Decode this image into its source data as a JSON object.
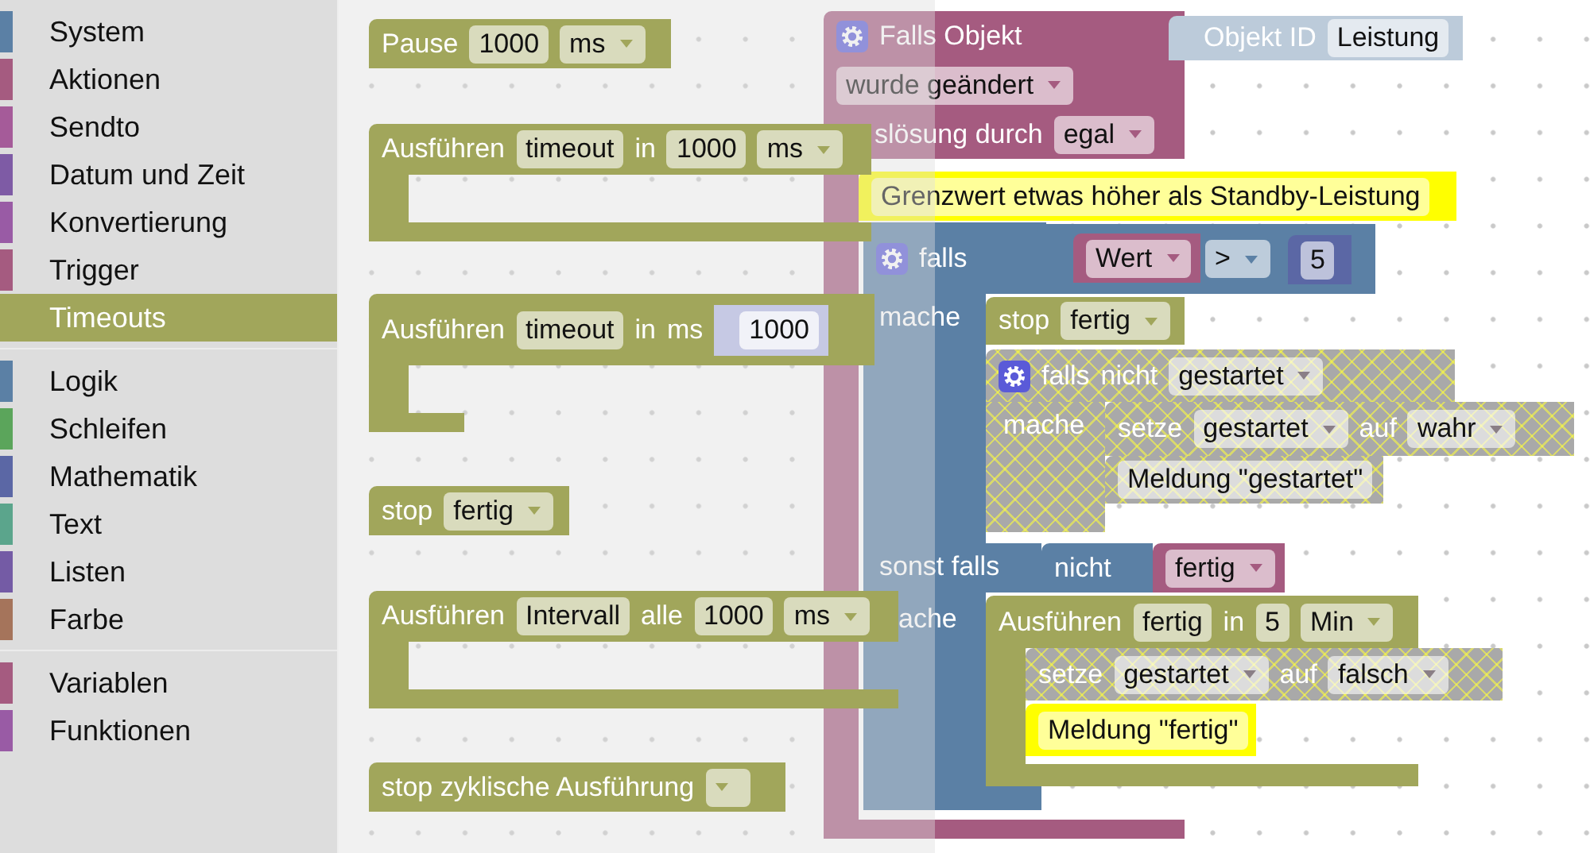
{
  "toolbox": {
    "groups": [
      [
        {
          "label": "System",
          "color": "#5b80a5",
          "selected": false
        },
        {
          "label": "Aktionen",
          "color": "#a55b80",
          "selected": false
        },
        {
          "label": "Sendto",
          "color": "#a55b99",
          "selected": false
        },
        {
          "label": "Datum und Zeit",
          "color": "#7e5ba5",
          "selected": false
        },
        {
          "label": "Konvertierung",
          "color": "#995ba5",
          "selected": false
        },
        {
          "label": "Trigger",
          "color": "#a55b80",
          "selected": false
        },
        {
          "label": "Timeouts",
          "color": "#a1a65b",
          "selected": true
        }
      ],
      [
        {
          "label": "Logik",
          "color": "#5b80a5",
          "selected": false
        },
        {
          "label": "Schleifen",
          "color": "#5ba55b",
          "selected": false
        },
        {
          "label": "Mathematik",
          "color": "#5b67a5",
          "selected": false
        },
        {
          "label": "Text",
          "color": "#5ba58c",
          "selected": false
        },
        {
          "label": "Listen",
          "color": "#745ba5",
          "selected": false
        },
        {
          "label": "Farbe",
          "color": "#a5745b",
          "selected": false
        }
      ],
      [
        {
          "label": "Variablen",
          "color": "#a55b80",
          "selected": false
        },
        {
          "label": "Funktionen",
          "color": "#995ba5",
          "selected": false
        }
      ]
    ]
  },
  "workspace": {
    "blocks": [
      {
        "color": "#a55b80",
        "lines": [
          [
            {
              "kind": "gear"
            },
            {
              "kind": "label",
              "text": "Falls Objekt"
            }
          ],
          [
            {
              "kind": "dropdown",
              "text": "wurde geändert"
            }
          ],
          [
            {
              "kind": "label",
              "text": "slösung durch"
            },
            {
              "kind": "dropdown",
              "text": "egal"
            }
          ]
        ]
      },
      {
        "color": "#bccbda",
        "lines": [
          [
            {
              "kind": "label",
              "text": "Objekt ID"
            },
            {
              "kind": "field",
              "text": "Leistung"
            }
          ]
        ]
      },
      {
        "color": "#ffff00",
        "lines": [
          [
            {
              "kind": "field",
              "text": "Grenzwert etwas höher als Standby-Leistung"
            }
          ]
        ]
      },
      {
        "color": "#5b80a5",
        "lines": [
          [
            {
              "kind": "gear"
            },
            {
              "kind": "label",
              "text": "falls"
            }
          ]
        ],
        "arm_labels": [
          "mache",
          "sonst falls",
          "ache"
        ]
      },
      {
        "color": "#a55b80",
        "lines": [
          [
            {
              "kind": "dropdown",
              "text": "Wert"
            }
          ]
        ]
      },
      {
        "color": "#5b80a5",
        "lines": [
          [
            {
              "kind": "dropdown",
              "text": ">"
            }
          ]
        ]
      },
      {
        "color": "#5b67a5",
        "lines": [
          [
            {
              "kind": "field",
              "text": "5"
            }
          ]
        ]
      },
      {
        "color": "#a1a65b",
        "lines": [
          [
            {
              "kind": "label",
              "text": "stop"
            },
            {
              "kind": "dropdown",
              "text": "fertig"
            }
          ]
        ]
      },
      {
        "disabled": true,
        "lines": [
          [
            {
              "kind": "gear"
            },
            {
              "kind": "label",
              "text": "falls"
            },
            {
              "kind": "label",
              "text": "nicht"
            },
            {
              "kind": "dropdown",
              "text": "gestartet"
            }
          ]
        ],
        "arm_labels": [
          "mache"
        ]
      },
      {
        "disabled": true,
        "lines": [
          [
            {
              "kind": "label",
              "text": "setze"
            },
            {
              "kind": "dropdown",
              "text": "gestartet"
            },
            {
              "kind": "label",
              "text": "auf"
            },
            {
              "kind": "dropdown",
              "text": "wahr"
            }
          ]
        ]
      },
      {
        "disabled": true,
        "lines": [
          [
            {
              "kind": "field",
              "text": "Meldung \"gestartet\""
            }
          ]
        ]
      },
      {
        "color": "#5b80a5",
        "lines": [
          [
            {
              "kind": "label",
              "text": "nicht"
            }
          ]
        ]
      },
      {
        "color": "#a55b80",
        "lines": [
          [
            {
              "kind": "dropdown",
              "text": "fertig"
            }
          ]
        ]
      },
      {
        "color": "#a1a65b",
        "lines": [
          [
            {
              "kind": "label",
              "text": "Ausführen"
            },
            {
              "kind": "field",
              "text": "fertig"
            },
            {
              "kind": "label",
              "text": "in"
            },
            {
              "kind": "field",
              "text": "5"
            },
            {
              "kind": "dropdown",
              "text": "Min"
            }
          ]
        ]
      },
      {
        "disabled": true,
        "lines": [
          [
            {
              "kind": "label",
              "text": "setze"
            },
            {
              "kind": "dropdown",
              "text": "gestartet"
            },
            {
              "kind": "label",
              "text": "auf"
            },
            {
              "kind": "dropdown",
              "text": "falsch"
            }
          ]
        ]
      },
      {
        "color": "#ffff00",
        "lines": [
          [
            {
              "kind": "field",
              "text": "Meldung \"fertig\""
            }
          ]
        ]
      }
    ]
  },
  "flyout": {
    "blocks": [
      {
        "color": "#a1a65b",
        "lines": [
          [
            {
              "kind": "label",
              "text": "Pause"
            },
            {
              "kind": "field",
              "text": "1000"
            },
            {
              "kind": "dropdown",
              "text": "ms"
            }
          ]
        ]
      },
      {
        "color": "#a1a65b",
        "lines": [
          [
            {
              "kind": "label",
              "text": "Ausführen"
            },
            {
              "kind": "field",
              "text": "timeout"
            },
            {
              "kind": "label",
              "text": "in"
            },
            {
              "kind": "field",
              "text": "1000"
            },
            {
              "kind": "dropdown",
              "text": "ms"
            }
          ]
        ]
      },
      {
        "color": "#a1a65b",
        "lines": [
          [
            {
              "kind": "label",
              "text": "Ausführen"
            },
            {
              "kind": "field",
              "text": "timeout"
            },
            {
              "kind": "label",
              "text": "in"
            },
            {
              "kind": "label",
              "text": "ms"
            },
            {
              "kind": "value",
              "text": "1000"
            }
          ]
        ]
      },
      {
        "color": "#a1a65b",
        "lines": [
          [
            {
              "kind": "label",
              "text": "stop"
            },
            {
              "kind": "dropdown",
              "text": "fertig"
            }
          ]
        ]
      },
      {
        "color": "#a1a65b",
        "lines": [
          [
            {
              "kind": "label",
              "text": "Ausführen"
            },
            {
              "kind": "field",
              "text": "Intervall"
            },
            {
              "kind": "label",
              "text": "alle"
            },
            {
              "kind": "field",
              "text": "1000"
            },
            {
              "kind": "dropdown",
              "text": "ms"
            }
          ]
        ]
      },
      {
        "color": "#a1a65b",
        "lines": [
          [
            {
              "kind": "label",
              "text": "stop zyklische Ausführung"
            },
            {
              "kind": "dropdown"
            }
          ]
        ]
      }
    ]
  }
}
